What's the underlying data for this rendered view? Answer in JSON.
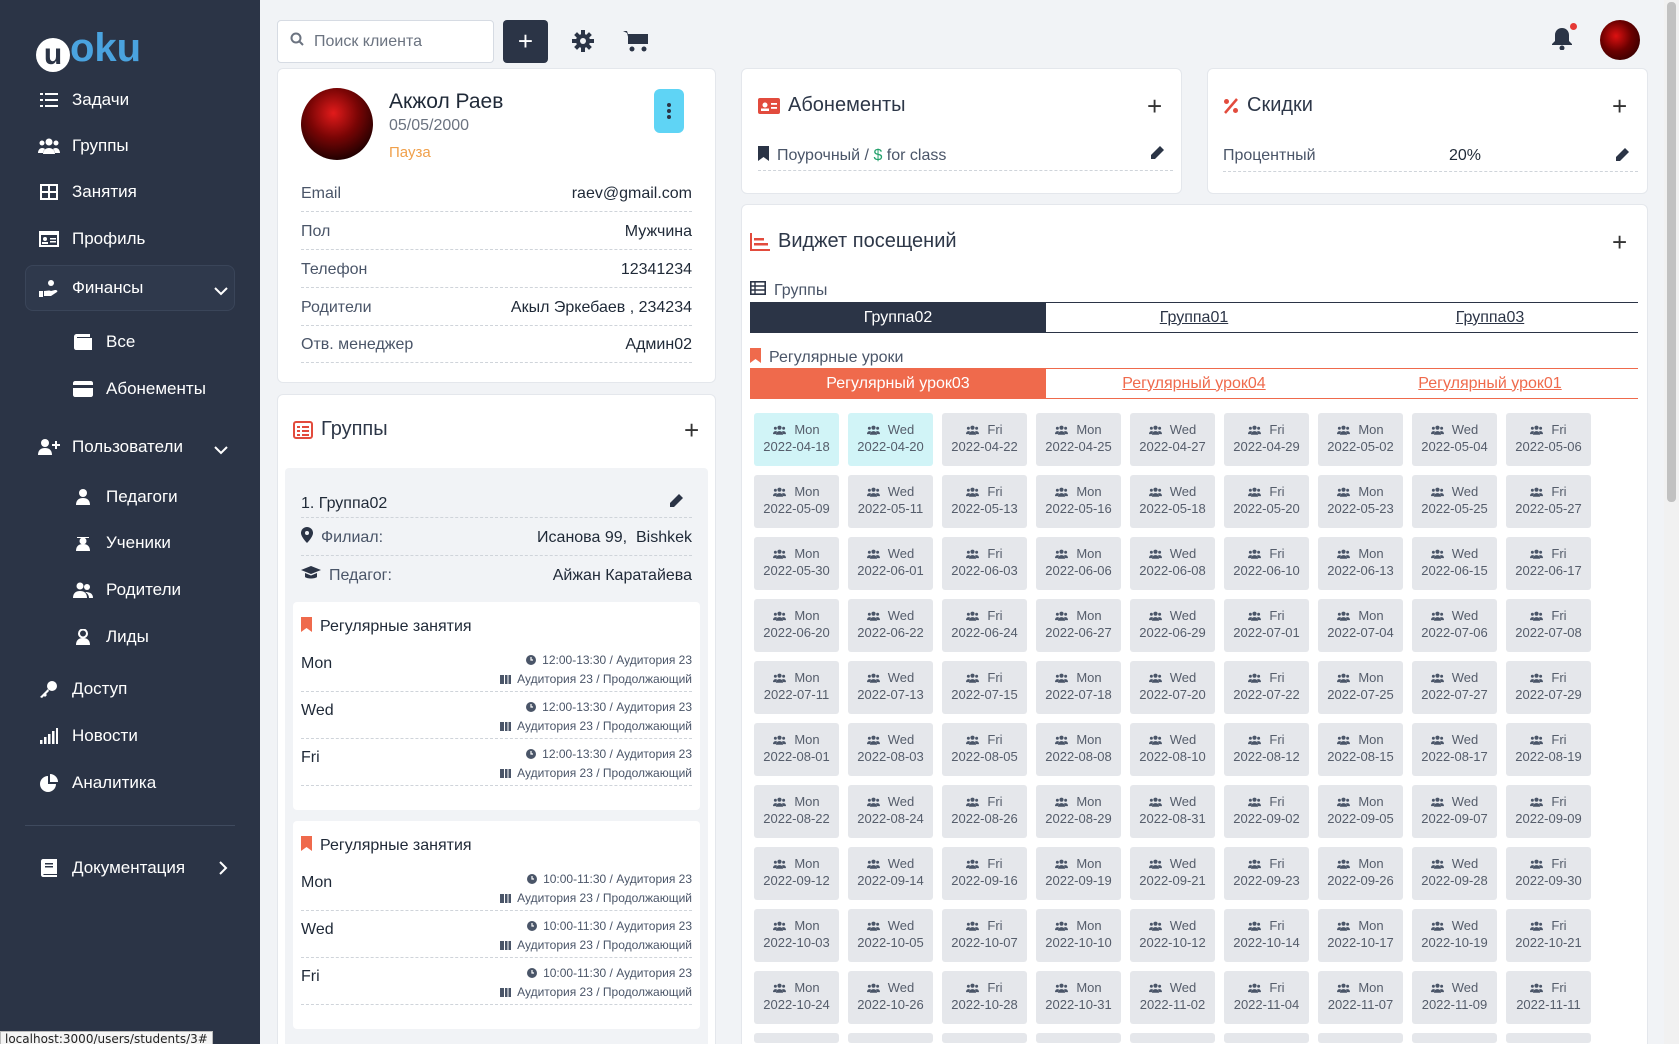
{
  "brand": {
    "logo_u": "u",
    "logo_rest": "oku"
  },
  "sidebar": {
    "items": [
      {
        "label": "Задачи",
        "icon": "list-icon"
      },
      {
        "label": "Группы",
        "icon": "users-icon"
      },
      {
        "label": "Занятия",
        "icon": "table-icon"
      },
      {
        "label": "Профиль",
        "icon": "id-card-icon"
      },
      {
        "label": "Финансы",
        "icon": "hand-coins-icon"
      },
      {
        "label": "Все",
        "icon": "wallet-icon"
      },
      {
        "label": "Абонементы",
        "icon": "credit-card-icon"
      },
      {
        "label": "Пользователи",
        "icon": "user-plus-icon"
      },
      {
        "label": "Педагоги",
        "icon": "user-icon"
      },
      {
        "label": "Ученики",
        "icon": "student-icon"
      },
      {
        "label": "Родители",
        "icon": "parents-icon"
      },
      {
        "label": "Лиды",
        "icon": "lead-icon"
      },
      {
        "label": "Доступ",
        "icon": "key-icon"
      },
      {
        "label": "Новости",
        "icon": "signal-icon"
      },
      {
        "label": "Аналитика",
        "icon": "pie-icon"
      },
      {
        "label": "Документация",
        "icon": "book-icon"
      }
    ]
  },
  "statusbar": {
    "url": "localhost:3000/users/students/3#"
  },
  "topbar": {
    "search_placeholder": "Поиск клиента",
    "add_label": "+"
  },
  "profile": {
    "name": "Акжол Раев",
    "birthdate": "05/05/2000",
    "status": "Пауза",
    "status_color": "#f0a04b",
    "rows": [
      {
        "label": "Email",
        "value": "raev@gmail.com"
      },
      {
        "label": "Пол",
        "value": "Мужчина"
      },
      {
        "label": "Телефон",
        "value": "12341234"
      },
      {
        "label": "Родители",
        "value": "Акыл Эркебаев , 234234"
      },
      {
        "label": "Отв. менеджер",
        "value": "Админ02"
      }
    ]
  },
  "groups_card": {
    "title": "Группы",
    "group_index": "1.",
    "group_name": "Группа02",
    "branch_label": "Филиал:",
    "branch_value": "Исанова 99,  Bishkek",
    "teacher_label": "Педагог:",
    "teacher_value": "Айжан Каратайева",
    "schedules": [
      {
        "title": "Регулярные занятия",
        "rows": [
          {
            "day": "Mon",
            "time": "12:00-13:30 / Аудитория 23",
            "room": "Аудитория 23 / Продолжающий"
          },
          {
            "day": "Wed",
            "time": "12:00-13:30 / Аудитория 23",
            "room": "Аудитория 23 / Продолжающий"
          },
          {
            "day": "Fri",
            "time": "12:00-13:30 / Аудитория 23",
            "room": "Аудитория 23 / Продолжающий"
          }
        ]
      },
      {
        "title": "Регулярные занятия",
        "rows": [
          {
            "day": "Mon",
            "time": "10:00-11:30 / Аудитория 23",
            "room": "Аудитория 23 / Продолжающий"
          },
          {
            "day": "Wed",
            "time": "10:00-11:30 / Аудитория 23",
            "room": "Аудитория 23 / Продолжающий"
          },
          {
            "day": "Fri",
            "time": "10:00-11:30 / Аудитория 23",
            "room": "Аудитория 23 / Продолжающий"
          }
        ]
      }
    ]
  },
  "subscriptions": {
    "title": "Абонементы",
    "item_prefix": "Поурочный /",
    "item_currency": "$",
    "item_suffix": "for class"
  },
  "discounts": {
    "title": "Скидки",
    "name": "Процентный",
    "value": "20%"
  },
  "attendance": {
    "title": "Виджет посещений",
    "groups_label": "Группы",
    "group_tabs": [
      "Группа02",
      "Группа01",
      "Группа03"
    ],
    "lessons_label": "Регулярные уроки",
    "lesson_tabs": [
      "Регулярный урок03",
      "Регулярный урок04",
      "Регулярный урок01"
    ],
    "colors": {
      "dark": "#2b3446",
      "accent": "#ef6a4c",
      "highlight": "#d1f4f7"
    },
    "days": [
      {
        "day": "Mon",
        "date": "2022-04-18",
        "highlighted": true
      },
      {
        "day": "Wed",
        "date": "2022-04-20",
        "highlighted": true
      },
      {
        "day": "Fri",
        "date": "2022-04-22"
      },
      {
        "day": "Mon",
        "date": "2022-04-25"
      },
      {
        "day": "Wed",
        "date": "2022-04-27"
      },
      {
        "day": "Fri",
        "date": "2022-04-29"
      },
      {
        "day": "Mon",
        "date": "2022-05-02"
      },
      {
        "day": "Wed",
        "date": "2022-05-04"
      },
      {
        "day": "Fri",
        "date": "2022-05-06"
      },
      {
        "day": "Mon",
        "date": "2022-05-09"
      },
      {
        "day": "Wed",
        "date": "2022-05-11"
      },
      {
        "day": "Fri",
        "date": "2022-05-13"
      },
      {
        "day": "Mon",
        "date": "2022-05-16"
      },
      {
        "day": "Wed",
        "date": "2022-05-18"
      },
      {
        "day": "Fri",
        "date": "2022-05-20"
      },
      {
        "day": "Mon",
        "date": "2022-05-23"
      },
      {
        "day": "Wed",
        "date": "2022-05-25"
      },
      {
        "day": "Fri",
        "date": "2022-05-27"
      },
      {
        "day": "Mon",
        "date": "2022-05-30"
      },
      {
        "day": "Wed",
        "date": "2022-06-01"
      },
      {
        "day": "Fri",
        "date": "2022-06-03"
      },
      {
        "day": "Mon",
        "date": "2022-06-06"
      },
      {
        "day": "Wed",
        "date": "2022-06-08"
      },
      {
        "day": "Fri",
        "date": "2022-06-10"
      },
      {
        "day": "Mon",
        "date": "2022-06-13"
      },
      {
        "day": "Wed",
        "date": "2022-06-15"
      },
      {
        "day": "Fri",
        "date": "2022-06-17"
      },
      {
        "day": "Mon",
        "date": "2022-06-20"
      },
      {
        "day": "Wed",
        "date": "2022-06-22"
      },
      {
        "day": "Fri",
        "date": "2022-06-24"
      },
      {
        "day": "Mon",
        "date": "2022-06-27"
      },
      {
        "day": "Wed",
        "date": "2022-06-29"
      },
      {
        "day": "Fri",
        "date": "2022-07-01"
      },
      {
        "day": "Mon",
        "date": "2022-07-04"
      },
      {
        "day": "Wed",
        "date": "2022-07-06"
      },
      {
        "day": "Fri",
        "date": "2022-07-08"
      },
      {
        "day": "Mon",
        "date": "2022-07-11"
      },
      {
        "day": "Wed",
        "date": "2022-07-13"
      },
      {
        "day": "Fri",
        "date": "2022-07-15"
      },
      {
        "day": "Mon",
        "date": "2022-07-18"
      },
      {
        "day": "Wed",
        "date": "2022-07-20"
      },
      {
        "day": "Fri",
        "date": "2022-07-22"
      },
      {
        "day": "Mon",
        "date": "2022-07-25"
      },
      {
        "day": "Wed",
        "date": "2022-07-27"
      },
      {
        "day": "Fri",
        "date": "2022-07-29"
      },
      {
        "day": "Mon",
        "date": "2022-08-01"
      },
      {
        "day": "Wed",
        "date": "2022-08-03"
      },
      {
        "day": "Fri",
        "date": "2022-08-05"
      },
      {
        "day": "Mon",
        "date": "2022-08-08"
      },
      {
        "day": "Wed",
        "date": "2022-08-10"
      },
      {
        "day": "Fri",
        "date": "2022-08-12"
      },
      {
        "day": "Mon",
        "date": "2022-08-15"
      },
      {
        "day": "Wed",
        "date": "2022-08-17"
      },
      {
        "day": "Fri",
        "date": "2022-08-19"
      },
      {
        "day": "Mon",
        "date": "2022-08-22"
      },
      {
        "day": "Wed",
        "date": "2022-08-24"
      },
      {
        "day": "Fri",
        "date": "2022-08-26"
      },
      {
        "day": "Mon",
        "date": "2022-08-29"
      },
      {
        "day": "Wed",
        "date": "2022-08-31"
      },
      {
        "day": "Fri",
        "date": "2022-09-02"
      },
      {
        "day": "Mon",
        "date": "2022-09-05"
      },
      {
        "day": "Wed",
        "date": "2022-09-07"
      },
      {
        "day": "Fri",
        "date": "2022-09-09"
      },
      {
        "day": "Mon",
        "date": "2022-09-12"
      },
      {
        "day": "Wed",
        "date": "2022-09-14"
      },
      {
        "day": "Fri",
        "date": "2022-09-16"
      },
      {
        "day": "Mon",
        "date": "2022-09-19"
      },
      {
        "day": "Wed",
        "date": "2022-09-21"
      },
      {
        "day": "Fri",
        "date": "2022-09-23"
      },
      {
        "day": "Mon",
        "date": "2022-09-26"
      },
      {
        "day": "Wed",
        "date": "2022-09-28"
      },
      {
        "day": "Fri",
        "date": "2022-09-30"
      },
      {
        "day": "Mon",
        "date": "2022-10-03"
      },
      {
        "day": "Wed",
        "date": "2022-10-05"
      },
      {
        "day": "Fri",
        "date": "2022-10-07"
      },
      {
        "day": "Mon",
        "date": "2022-10-10"
      },
      {
        "day": "Wed",
        "date": "2022-10-12"
      },
      {
        "day": "Fri",
        "date": "2022-10-14"
      },
      {
        "day": "Mon",
        "date": "2022-10-17"
      },
      {
        "day": "Wed",
        "date": "2022-10-19"
      },
      {
        "day": "Fri",
        "date": "2022-10-21"
      },
      {
        "day": "Mon",
        "date": "2022-10-24"
      },
      {
        "day": "Wed",
        "date": "2022-10-26"
      },
      {
        "day": "Fri",
        "date": "2022-10-28"
      },
      {
        "day": "Mon",
        "date": "2022-10-31"
      },
      {
        "day": "Wed",
        "date": "2022-11-02"
      },
      {
        "day": "Fri",
        "date": "2022-11-04"
      },
      {
        "day": "Mon",
        "date": "2022-11-07"
      },
      {
        "day": "Wed",
        "date": "2022-11-09"
      },
      {
        "day": "Fri",
        "date": "2022-11-11"
      }
    ]
  }
}
